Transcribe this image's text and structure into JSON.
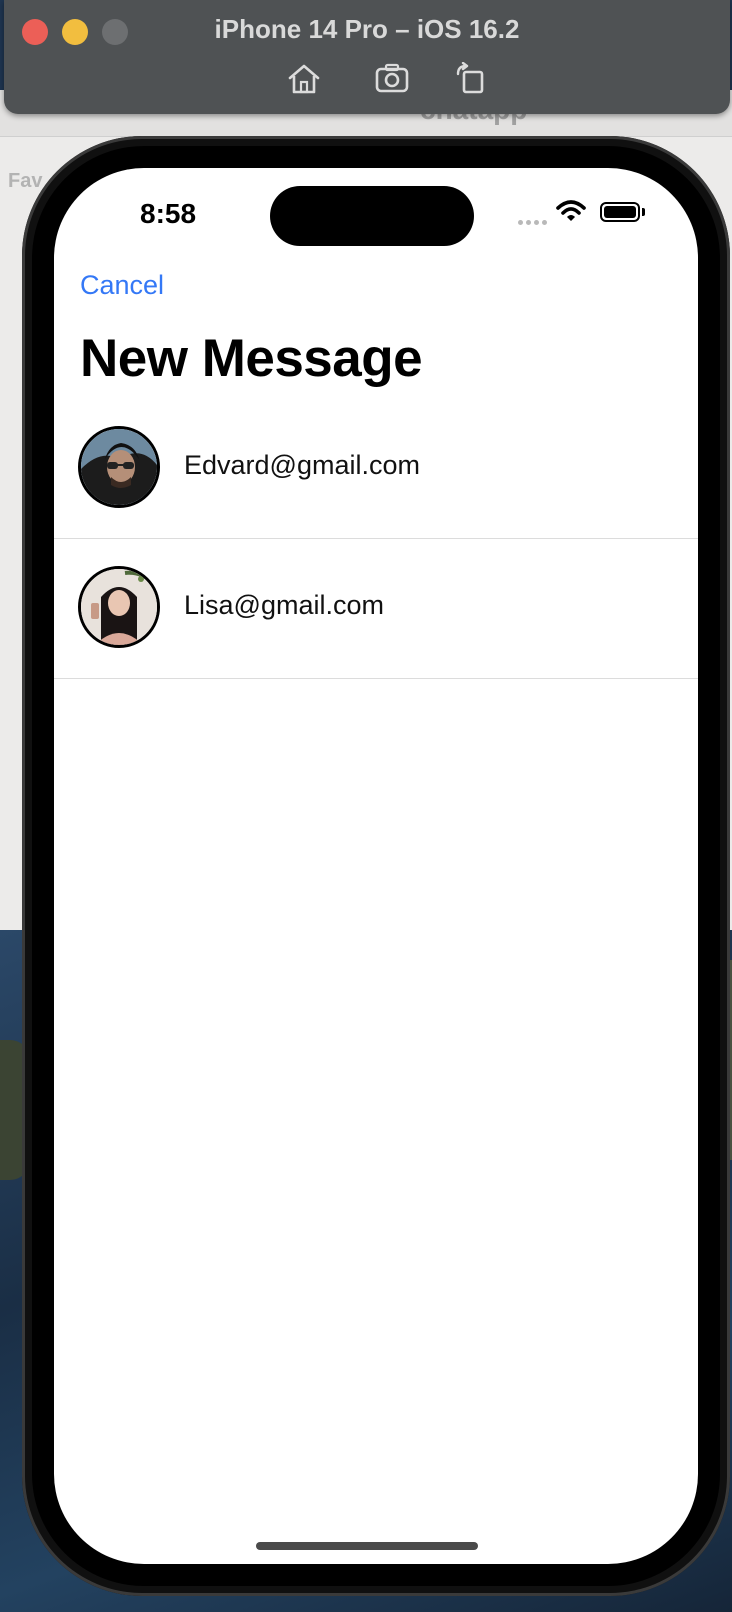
{
  "simulator": {
    "title": "iPhone 14 Pro – iOS 16.2",
    "buttons": [
      "home-icon",
      "screenshot-icon",
      "rotate-icon"
    ]
  },
  "background_window": {
    "title": "chatapp",
    "sidebar_label": "Fav"
  },
  "status_bar": {
    "time": "8:58"
  },
  "nav": {
    "cancel_label": "Cancel",
    "title": "New Message"
  },
  "contacts": [
    {
      "email": "Edvard@gmail.com",
      "avatar": "avatar-edvard"
    },
    {
      "email": "Lisa@gmail.com",
      "avatar": "avatar-lisa"
    }
  ],
  "colors": {
    "accent": "#3478f6",
    "separator": "#dcdcdc"
  }
}
